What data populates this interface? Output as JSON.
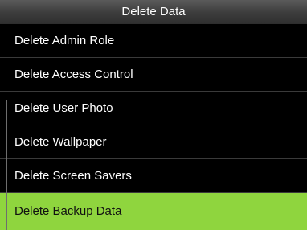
{
  "window": {
    "title": "Delete Data"
  },
  "menu": {
    "items": [
      {
        "label": "Delete Admin Role"
      },
      {
        "label": "Delete Access Control"
      },
      {
        "label": "Delete User Photo"
      },
      {
        "label": "Delete Wallpaper"
      },
      {
        "label": "Delete Screen Savers"
      },
      {
        "label": "Delete Backup Data"
      }
    ],
    "selected_index": 5
  },
  "colors": {
    "background": "#000000",
    "selection": "#8fd53e",
    "text": "#ffffff"
  }
}
